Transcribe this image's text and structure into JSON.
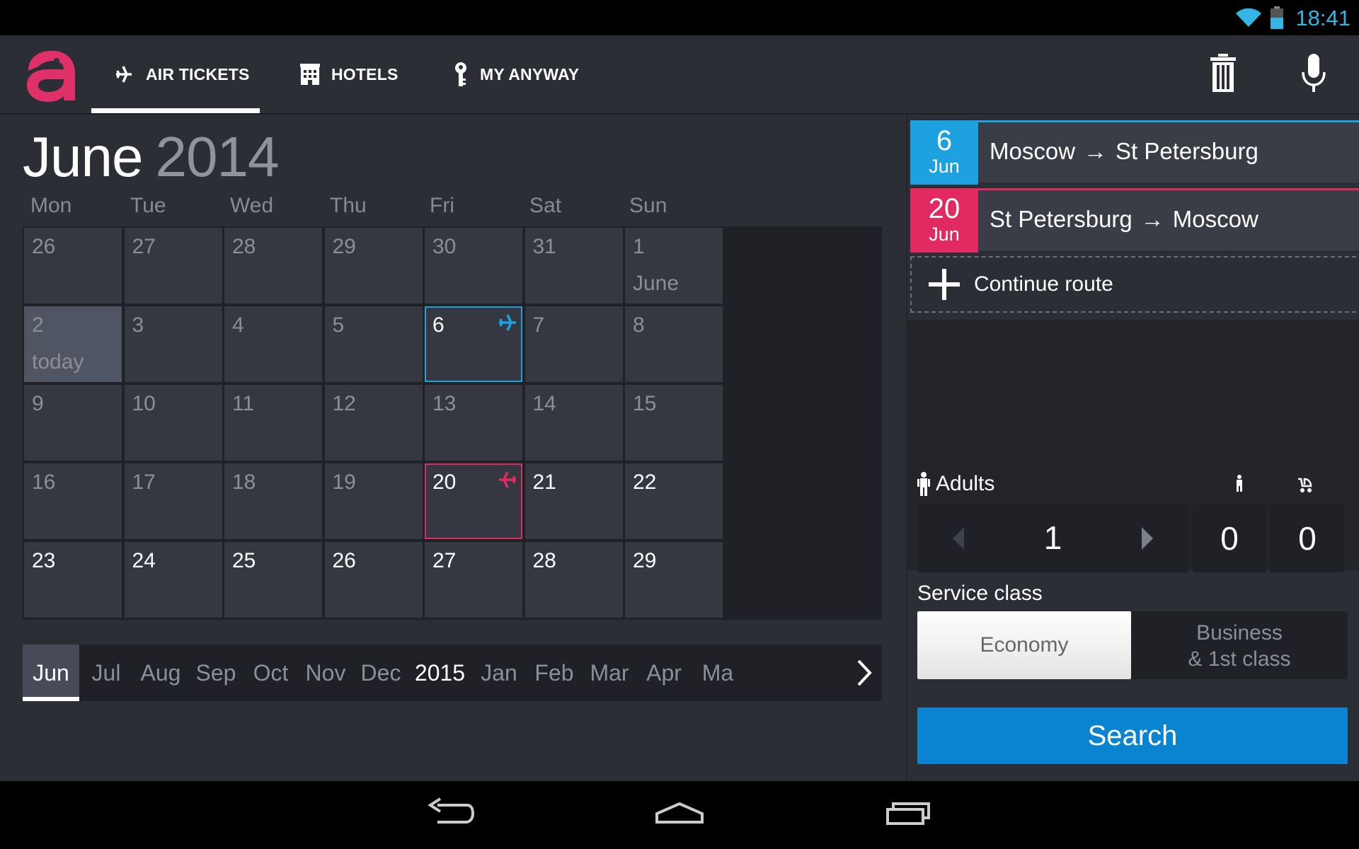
{
  "status": {
    "time": "18:41"
  },
  "tabs": [
    {
      "label": "AIR TICKETS",
      "icon": "plane-icon",
      "active": true
    },
    {
      "label": "HOTELS",
      "icon": "hotel-icon",
      "active": false
    },
    {
      "label": "MY ANYWAY",
      "icon": "key-icon",
      "active": false
    }
  ],
  "calendar": {
    "month": "June",
    "year": "2014",
    "weekdays": [
      "Mon",
      "Tue",
      "Wed",
      "Thu",
      "Fri",
      "Sat",
      "Sun"
    ],
    "weeks": [
      [
        {
          "n": "26",
          "dim": true
        },
        {
          "n": "27",
          "dim": true
        },
        {
          "n": "28",
          "dim": true
        },
        {
          "n": "29",
          "dim": true
        },
        {
          "n": "30",
          "dim": true
        },
        {
          "n": "31",
          "dim": true
        },
        {
          "n": "1",
          "dim": true,
          "sub": "June"
        }
      ],
      [
        {
          "n": "2",
          "dim": true,
          "sub": "today",
          "today": true
        },
        {
          "n": "3",
          "dim": true
        },
        {
          "n": "4",
          "dim": true
        },
        {
          "n": "5",
          "dim": true
        },
        {
          "n": "6",
          "sel": "blue"
        },
        {
          "n": "7",
          "dim": true
        },
        {
          "n": "8",
          "dim": true
        }
      ],
      [
        {
          "n": "9",
          "dim": true
        },
        {
          "n": "10",
          "dim": true
        },
        {
          "n": "11",
          "dim": true
        },
        {
          "n": "12",
          "dim": true
        },
        {
          "n": "13",
          "dim": true
        },
        {
          "n": "14",
          "dim": true
        },
        {
          "n": "15",
          "dim": true
        }
      ],
      [
        {
          "n": "16",
          "dim": true
        },
        {
          "n": "17",
          "dim": true
        },
        {
          "n": "18",
          "dim": true
        },
        {
          "n": "19",
          "dim": true
        },
        {
          "n": "20",
          "sel": "red"
        },
        {
          "n": "21"
        },
        {
          "n": "22"
        }
      ],
      [
        {
          "n": "23"
        },
        {
          "n": "24"
        },
        {
          "n": "25"
        },
        {
          "n": "26"
        },
        {
          "n": "27"
        },
        {
          "n": "28"
        },
        {
          "n": "29"
        }
      ]
    ]
  },
  "month_strip": [
    {
      "label": "Jun",
      "active": true
    },
    {
      "label": "Jul"
    },
    {
      "label": "Aug"
    },
    {
      "label": "Sep"
    },
    {
      "label": "Oct"
    },
    {
      "label": "Nov"
    },
    {
      "label": "Dec"
    },
    {
      "label": "2015",
      "year": true
    },
    {
      "label": "Jan"
    },
    {
      "label": "Feb"
    },
    {
      "label": "Mar"
    },
    {
      "label": "Apr"
    },
    {
      "label": "Ma"
    }
  ],
  "routes": [
    {
      "day": "6",
      "month": "Jun",
      "from": "Moscow",
      "to": "St Petersburg",
      "color": "#1ea1e0"
    },
    {
      "day": "20",
      "month": "Jun",
      "from": "St Petersburg",
      "to": "Moscow",
      "color": "#e02a60"
    }
  ],
  "continue_route": "Continue route",
  "passengers": {
    "adults_label": "Adults",
    "adults": "1",
    "children": "0",
    "infants": "0"
  },
  "service": {
    "label": "Service class",
    "economy": "Economy",
    "business_line1": "Business",
    "business_line2": "& 1st class"
  },
  "search_label": "Search",
  "colors": {
    "accent_blue": "#1ea1e0",
    "accent_red": "#e02a60",
    "brand": "#e0306a",
    "search": "#0a84d0"
  }
}
